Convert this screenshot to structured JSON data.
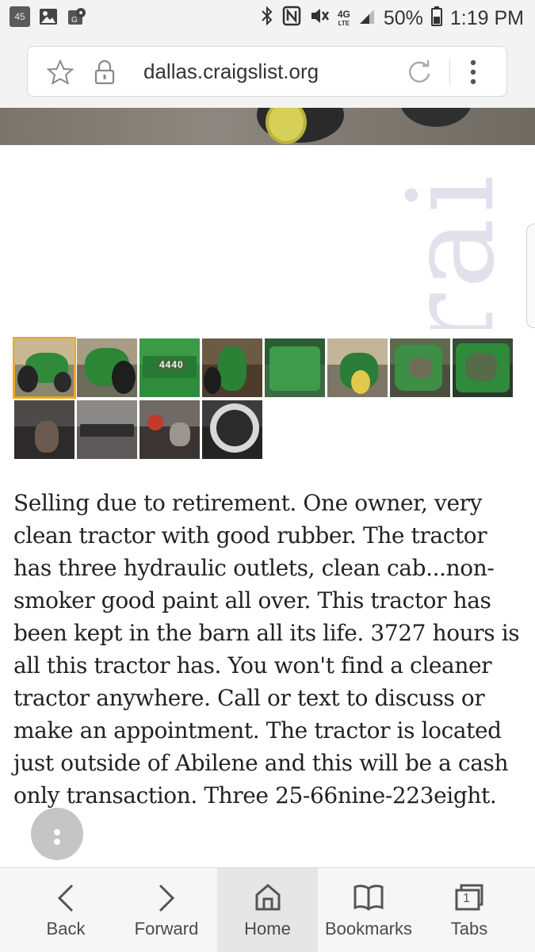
{
  "status_bar": {
    "badge": "45",
    "battery": "50%",
    "time": "1:19 PM",
    "network": "4G",
    "network_sub": "LTE"
  },
  "browser": {
    "url": "dallas.craigslist.org"
  },
  "watermark": "rai",
  "thumbnails": {
    "selected_index": 0,
    "label_4440": "4440",
    "count": 12
  },
  "listing": {
    "description": "Selling due to retirement. One owner, very clean tractor with good rubber. The tractor has three hydraulic outlets, clean cab...non-smoker good paint all over. This tractor has been kept in the barn all its life. 3727 hours is all this tractor has. You won't find a cleaner tractor anywhere. Call or text to discuss or make an appointment. The tractor is located just outside of Abilene and this will be a cash only transaction. Three 25-66nine-223eight."
  },
  "bottom_nav": {
    "back": "Back",
    "forward": "Forward",
    "home": "Home",
    "bookmarks": "Bookmarks",
    "tabs": "Tabs",
    "tab_count": "1"
  },
  "colors": {
    "selected_outline": "#f2a71c",
    "tractor_green": "#2f8a3a",
    "tractor_yellow": "#d6cf58"
  }
}
